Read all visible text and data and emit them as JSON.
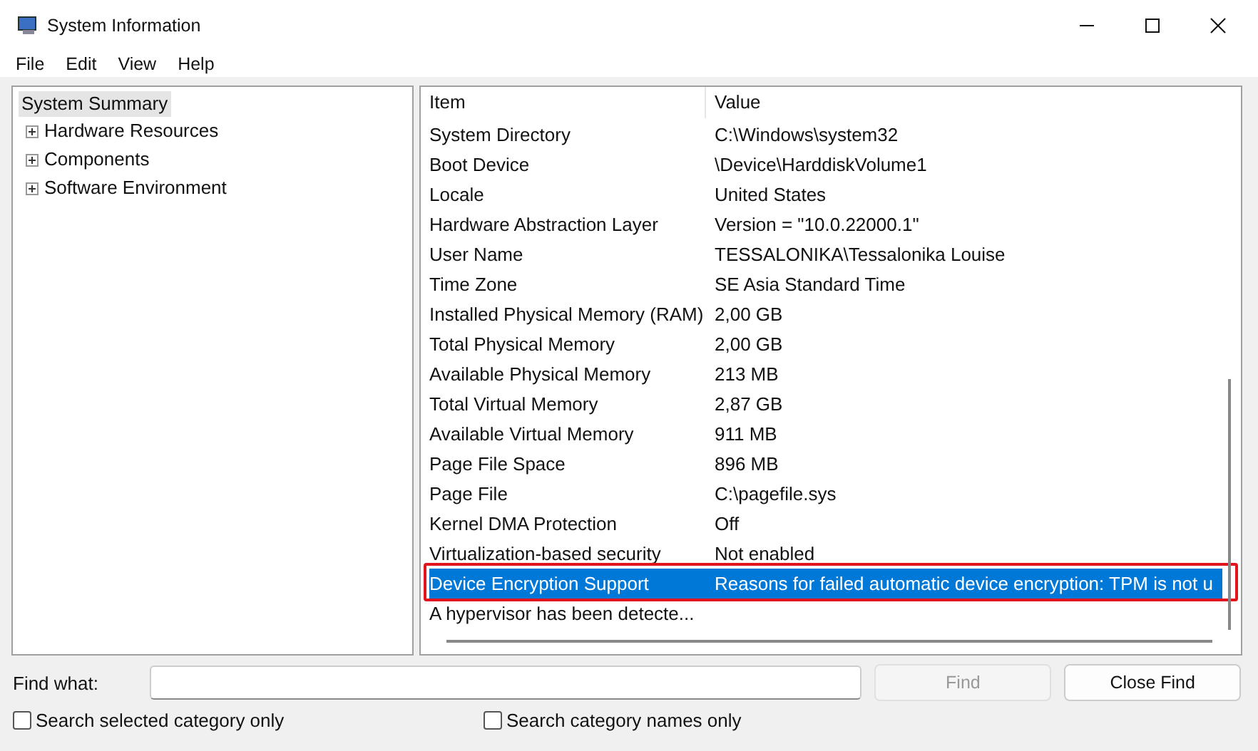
{
  "window": {
    "title": "System Information"
  },
  "menu": [
    "File",
    "Edit",
    "View",
    "Help"
  ],
  "tree": [
    {
      "label": "System Summary",
      "selected": true,
      "children": [
        {
          "label": "Hardware Resources",
          "selected": false,
          "expanded": false
        },
        {
          "label": "Components",
          "selected": false,
          "expanded": false
        },
        {
          "label": "Software Environment",
          "selected": false,
          "expanded": false
        }
      ]
    }
  ],
  "table": {
    "columns": [
      "Item",
      "Value"
    ],
    "rows": [
      {
        "item": "System Directory",
        "value": "C:\\Windows\\system32",
        "selected": false
      },
      {
        "item": "Boot Device",
        "value": "\\Device\\HarddiskVolume1",
        "selected": false
      },
      {
        "item": "Locale",
        "value": "United States",
        "selected": false
      },
      {
        "item": "Hardware Abstraction Layer",
        "value": "Version = \"10.0.22000.1\"",
        "selected": false
      },
      {
        "item": "User Name",
        "value": "TESSALONIKA\\Tessalonika Louise",
        "selected": false
      },
      {
        "item": "Time Zone",
        "value": "SE Asia Standard Time",
        "selected": false
      },
      {
        "item": "Installed Physical Memory (RAM)",
        "value": "2,00 GB",
        "selected": false
      },
      {
        "item": "Total Physical Memory",
        "value": "2,00 GB",
        "selected": false
      },
      {
        "item": "Available Physical Memory",
        "value": "213 MB",
        "selected": false
      },
      {
        "item": "Total Virtual Memory",
        "value": "2,87 GB",
        "selected": false
      },
      {
        "item": "Available Virtual Memory",
        "value": "911 MB",
        "selected": false
      },
      {
        "item": "Page File Space",
        "value": "896 MB",
        "selected": false
      },
      {
        "item": "Page File",
        "value": "C:\\pagefile.sys",
        "selected": false
      },
      {
        "item": "Kernel DMA Protection",
        "value": "Off",
        "selected": false
      },
      {
        "item": "Virtualization-based security",
        "value": "Not enabled",
        "selected": false
      },
      {
        "item": "Device Encryption Support",
        "value": "Reasons for failed automatic device encryption: TPM is not u",
        "selected": true
      },
      {
        "item": "A hypervisor has been detecte...",
        "value": "",
        "selected": false
      }
    ]
  },
  "find": {
    "label": "Find what:",
    "find_button": {
      "label": "Find",
      "disabled": true
    },
    "close_button": {
      "label": "Close Find",
      "disabled": false
    },
    "options": [
      {
        "label": "Search selected category only",
        "checked": false
      },
      {
        "label": "Search category names only",
        "checked": false
      }
    ]
  }
}
